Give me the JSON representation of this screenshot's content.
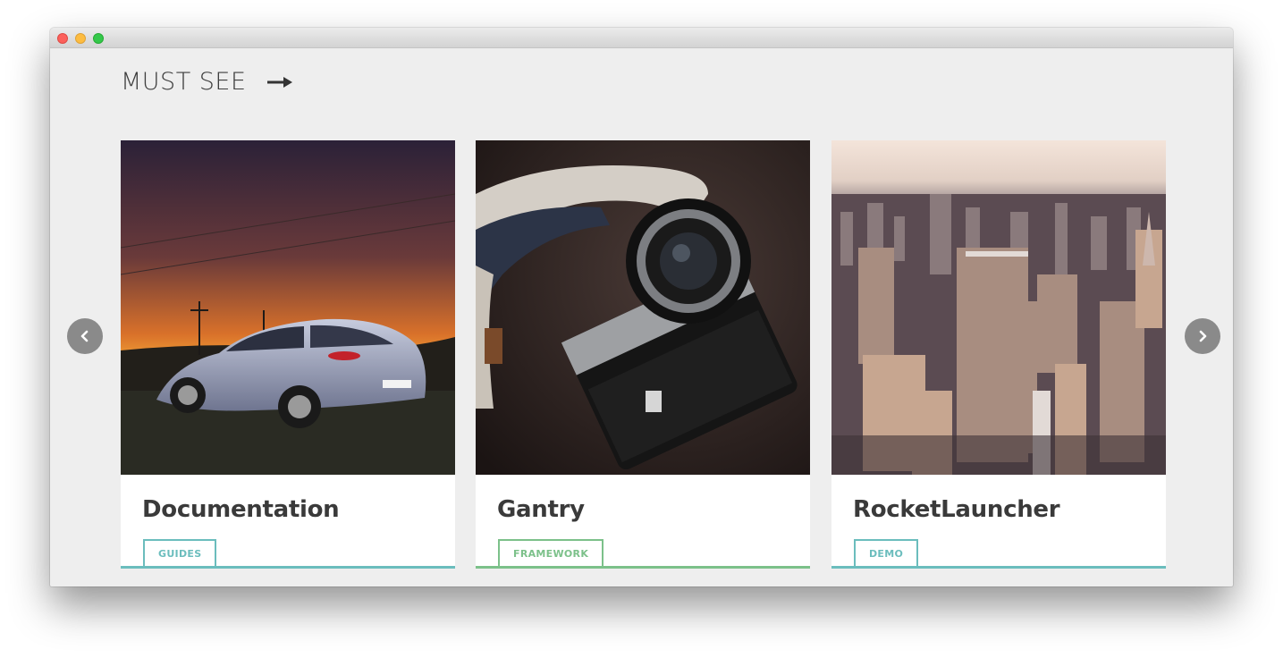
{
  "window": {
    "controls": [
      "close",
      "minimize",
      "zoom"
    ]
  },
  "section": {
    "heading": "MUST SEE",
    "arrow_icon": "arrow-right-icon"
  },
  "carousel": {
    "prev_icon": "chevron-left-icon",
    "next_icon": "chevron-right-icon"
  },
  "cards": [
    {
      "title": "Documentation",
      "tag": "GUIDES",
      "image": "car at sunset photo",
      "accent": "#6bbdbd"
    },
    {
      "title": "Gantry",
      "tag": "FRAMEWORK",
      "image": "vintage camera photo",
      "accent": "#7cc18a"
    },
    {
      "title": "RocketLauncher",
      "tag": "DEMO",
      "image": "city skyline aerial photo",
      "accent": "#6bbdbd"
    }
  ],
  "colors": {
    "background": "#eeeeee",
    "card": "#ffffff",
    "nav_button": "#8a8a8a",
    "teal_accent": "#6bbdbd",
    "green_accent": "#7cc18a"
  }
}
